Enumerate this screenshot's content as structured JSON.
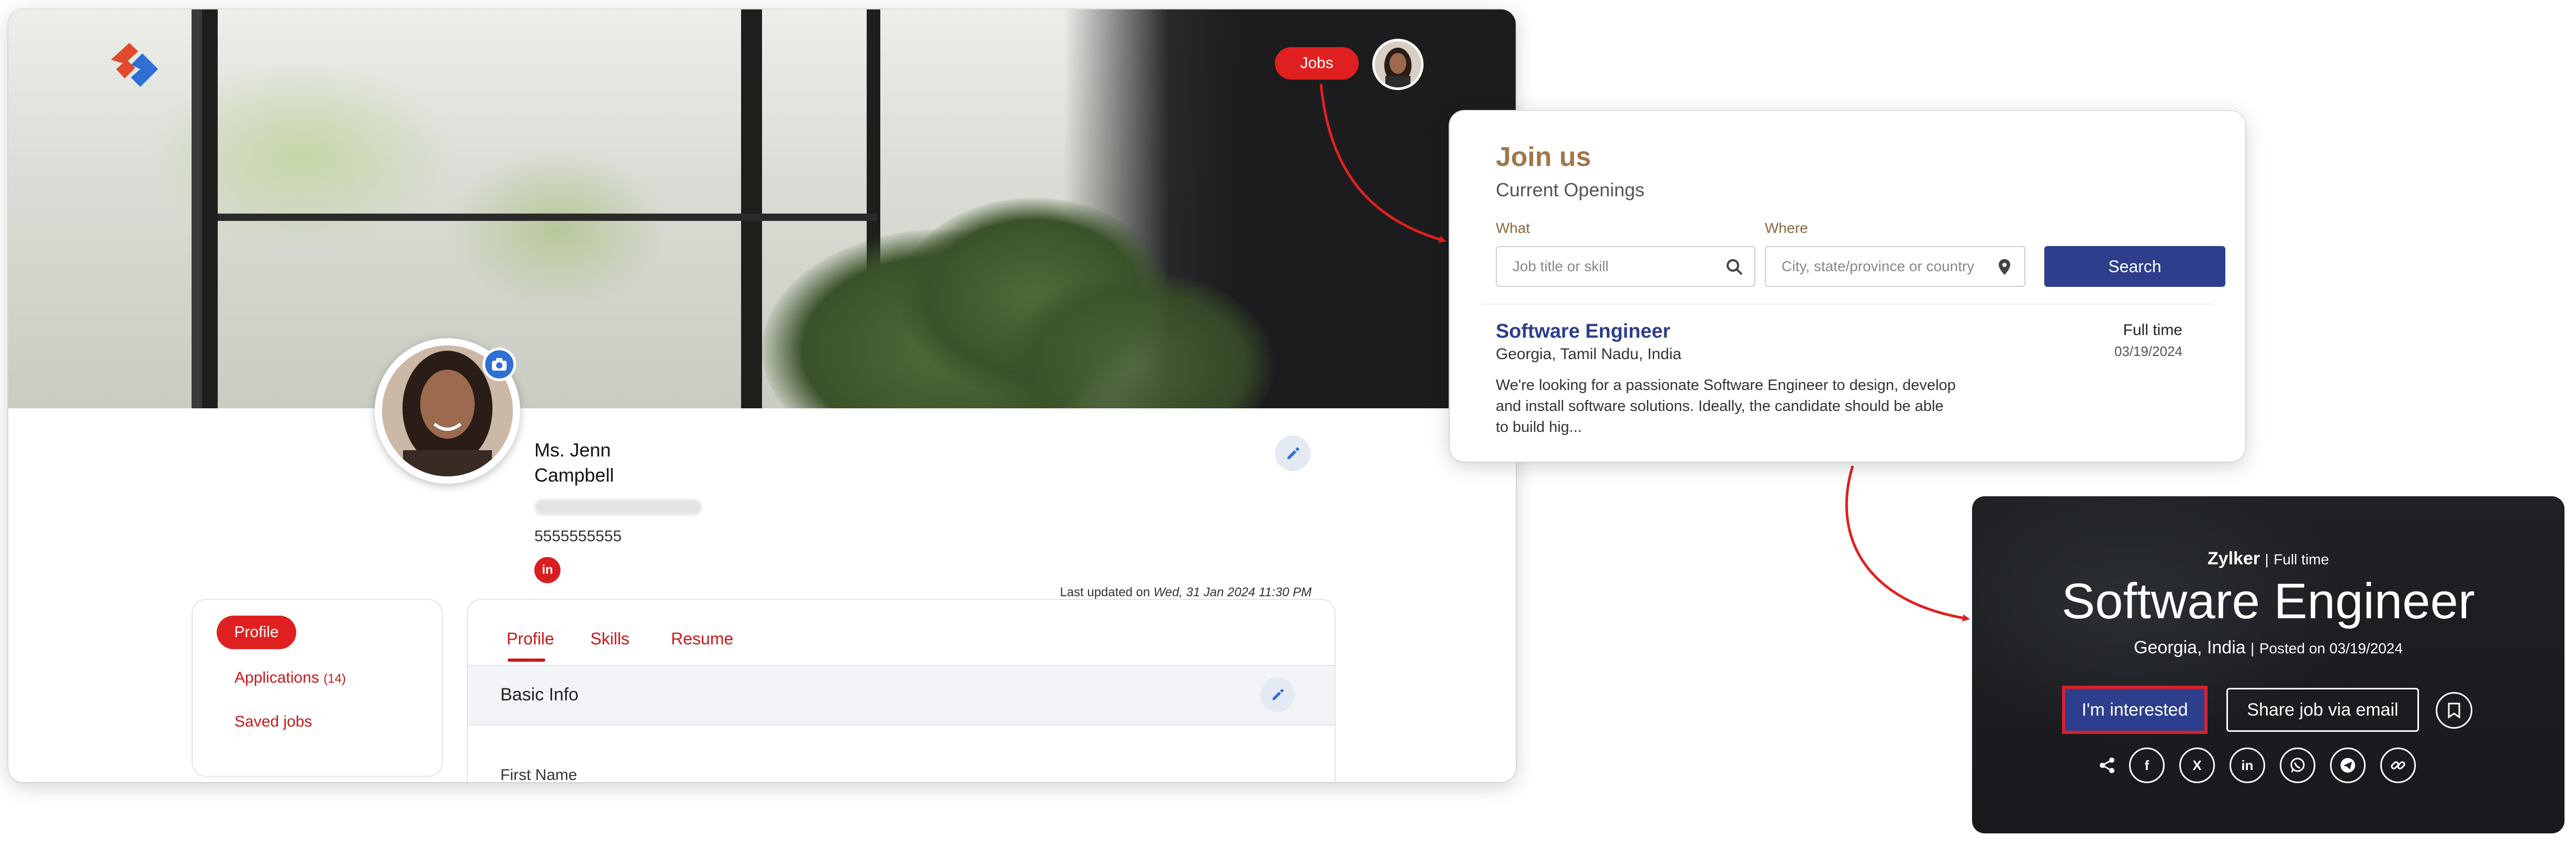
{
  "profile_page": {
    "header": {
      "jobs_label": "Jobs"
    },
    "profile": {
      "name_line1": "Ms. Jenn",
      "name_line2": "Campbell",
      "phone": "5555555555",
      "linkedin_glyph": "in",
      "last_updated_prefix": "Last updated on",
      "last_updated_value": "Wed, 31 Jan 2024 11:30 PM"
    },
    "sidebar": {
      "active": "Profile",
      "applications_label": "Applications",
      "applications_count": "(14)",
      "saved_jobs_label": "Saved jobs"
    },
    "tabs": [
      {
        "label": "Profile"
      },
      {
        "label": "Skills"
      },
      {
        "label": "Resume"
      }
    ],
    "section": {
      "title": "Basic Info",
      "first_field_label": "First Name"
    }
  },
  "join_panel": {
    "title": "Join us",
    "subtitle": "Current Openings",
    "what_label": "What",
    "what_placeholder": "Job title or skill",
    "where_label": "Where",
    "where_placeholder": "City, state/province or country",
    "search_label": "Search",
    "job": {
      "title": "Software Engineer",
      "location": "Georgia, Tamil Nadu, India",
      "type": "Full time",
      "date": "03/19/2024",
      "description": "We're looking for a passionate Software Engineer to design, develop and install software solutions. Ideally, the candidate should be able to build hig..."
    }
  },
  "job_hero": {
    "company": "Zylker",
    "separator": "|",
    "type": "Full time",
    "title": "Software Engineer",
    "location": "Georgia, India",
    "posted": "Posted on 03/19/2024",
    "interested_label": "I'm interested",
    "share_email_label": "Share job via email",
    "social_icons": [
      "share-icon",
      "facebook-icon",
      "x-icon",
      "linkedin-icon",
      "whatsapp-icon",
      "telegram-icon",
      "link-icon"
    ],
    "social_glyphs": {
      "facebook": "f",
      "x": "X",
      "linkedin": "in"
    }
  },
  "colors": {
    "brand_red": "#e02020",
    "brand_navy": "#2d3e8c",
    "accent_gold": "#a0774a",
    "focus_border": "#d8222c"
  }
}
